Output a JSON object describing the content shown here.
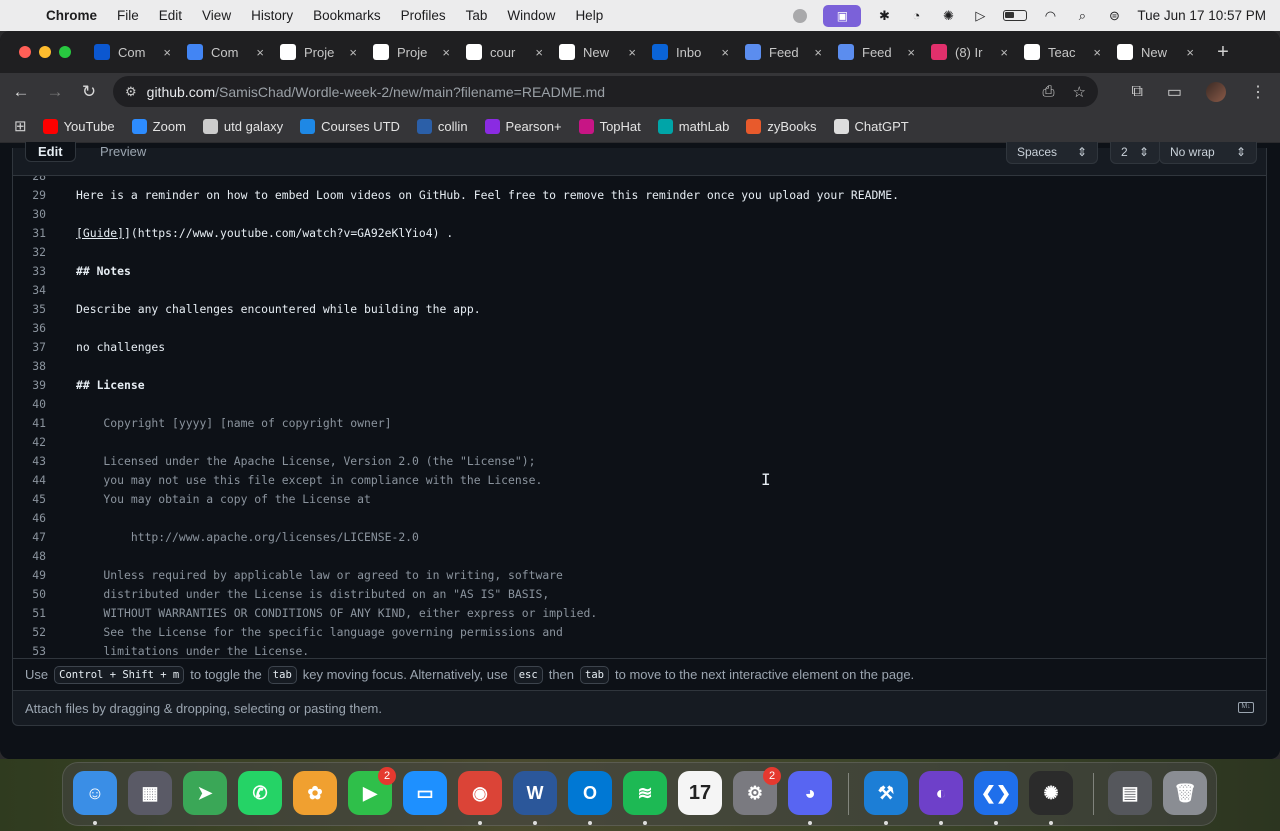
{
  "menubar": {
    "items": [
      "Chrome",
      "File",
      "Edit",
      "View",
      "History",
      "Bookmarks",
      "Profiles",
      "Tab",
      "Window",
      "Help"
    ],
    "clock": "Tue Jun 17  10:57 PM"
  },
  "tabs": [
    {
      "label": "Com",
      "icon": "docs",
      "color": "#0b57d0"
    },
    {
      "label": "Com",
      "icon": "docs",
      "color": "#4285f4"
    },
    {
      "label": "Proje",
      "icon": "codepath",
      "color": "#ffffff"
    },
    {
      "label": "Proje",
      "icon": "codepath",
      "color": "#ffffff"
    },
    {
      "label": "cour",
      "icon": "codepath",
      "color": "#ffffff"
    },
    {
      "label": "New",
      "icon": "github",
      "color": "#ffffff"
    },
    {
      "label": "Inbo",
      "icon": "outlook",
      "color": "#0a64d8"
    },
    {
      "label": "Feed",
      "icon": "feedback",
      "color": "#5b8def"
    },
    {
      "label": "Feed",
      "icon": "feedback",
      "color": "#5b8def"
    },
    {
      "label": "(8) Ir",
      "icon": "instagram",
      "color": "#e1306c"
    },
    {
      "label": "Teac",
      "icon": "openai",
      "color": "#ffffff"
    },
    {
      "label": "New",
      "icon": "chrome",
      "color": "#ffffff"
    }
  ],
  "address": {
    "host": "github.com",
    "path": "/SamisChad/Wordle-week-2/new/main?filename=README.md"
  },
  "bookmarks": [
    {
      "label": "YouTube",
      "color": "#ff0000"
    },
    {
      "label": "Zoom",
      "color": "#2d8cff"
    },
    {
      "label": "utd galaxy",
      "color": "#cccccc"
    },
    {
      "label": "Courses UTD",
      "color": "#1e88e5"
    },
    {
      "label": "collin",
      "color": "#2b5fa8"
    },
    {
      "label": "Pearson+",
      "color": "#8a2be2"
    },
    {
      "label": "TopHat",
      "color": "#c71585"
    },
    {
      "label": "mathLab",
      "color": "#00a5a8"
    },
    {
      "label": "zyBooks",
      "color": "#e85a2c"
    },
    {
      "label": "ChatGPT",
      "color": "#dddddd"
    }
  ],
  "editor": {
    "tab_edit": "Edit",
    "tab_preview": "Preview",
    "indent_mode": "Spaces",
    "indent_size": "2",
    "wrap_mode": "No wrap",
    "lines": [
      {
        "n": "28",
        "text": "",
        "style": ""
      },
      {
        "n": "29",
        "text": "Here is a reminder on how to embed Loom videos on GitHub. Feel free to remove this reminder once you upload your README.",
        "style": ""
      },
      {
        "n": "30",
        "text": "",
        "style": ""
      },
      {
        "n": "31",
        "text": "[Guide]](https://www.youtube.com/watch?v=GA92eKlYio4) .",
        "style": "link"
      },
      {
        "n": "32",
        "text": "",
        "style": ""
      },
      {
        "n": "33",
        "text": "## Notes",
        "style": "h"
      },
      {
        "n": "34",
        "text": "",
        "style": ""
      },
      {
        "n": "35",
        "text": "Describe any challenges encountered while building the app.",
        "style": ""
      },
      {
        "n": "36",
        "text": "",
        "style": ""
      },
      {
        "n": "37",
        "text": "no challenges",
        "style": ""
      },
      {
        "n": "38",
        "text": "",
        "style": ""
      },
      {
        "n": "39",
        "text": "## License",
        "style": "h"
      },
      {
        "n": "40",
        "text": "",
        "style": ""
      },
      {
        "n": "41",
        "text": "    Copyright [yyyy] [name of copyright owner]",
        "style": "muted"
      },
      {
        "n": "42",
        "text": "",
        "style": ""
      },
      {
        "n": "43",
        "text": "    Licensed under the Apache License, Version 2.0 (the \"License\");",
        "style": "muted"
      },
      {
        "n": "44",
        "text": "    you may not use this file except in compliance with the License.",
        "style": "muted"
      },
      {
        "n": "45",
        "text": "    You may obtain a copy of the License at",
        "style": "muted"
      },
      {
        "n": "46",
        "text": "",
        "style": ""
      },
      {
        "n": "47",
        "text": "        http://www.apache.org/licenses/LICENSE-2.0",
        "style": "muted"
      },
      {
        "n": "48",
        "text": "",
        "style": ""
      },
      {
        "n": "49",
        "text": "    Unless required by applicable law or agreed to in writing, software",
        "style": "muted"
      },
      {
        "n": "50",
        "text": "    distributed under the License is distributed on an \"AS IS\" BASIS,",
        "style": "muted"
      },
      {
        "n": "51",
        "text": "    WITHOUT WARRANTIES OR CONDITIONS OF ANY KIND, either express or implied.",
        "style": "muted"
      },
      {
        "n": "52",
        "text": "    See the License for the specific language governing permissions and",
        "style": "muted"
      },
      {
        "n": "53",
        "text": "    limitations under the License.",
        "style": "muted"
      }
    ]
  },
  "hint": {
    "use": "Use",
    "kbd1": "Control + Shift + m",
    "text1": "to toggle the",
    "kbd2": "tab",
    "text2": "key moving focus. Alternatively, use",
    "kbd3": "esc",
    "text3": "then",
    "kbd4": "tab",
    "text4": "to move to the next interactive element on the page."
  },
  "attach_text": "Attach files by dragging & dropping, selecting or pasting them.",
  "dock": {
    "items": [
      {
        "name": "finder",
        "glyph": "☺",
        "color": "#3a8ee6",
        "running": true,
        "badge": ""
      },
      {
        "name": "launchpad",
        "glyph": "▦",
        "color": "#5a5a66",
        "running": false,
        "badge": ""
      },
      {
        "name": "maps",
        "glyph": "➤",
        "color": "#3aa757",
        "running": false,
        "badge": ""
      },
      {
        "name": "whatsapp",
        "glyph": "✆",
        "color": "#25d366",
        "running": false,
        "badge": ""
      },
      {
        "name": "photos",
        "glyph": "✿",
        "color": "#f0a030",
        "running": false,
        "badge": ""
      },
      {
        "name": "facetime",
        "glyph": "▶",
        "color": "#2fbf4a",
        "running": false,
        "badge": "2"
      },
      {
        "name": "keynote",
        "glyph": "▭",
        "color": "#1e90ff",
        "running": false,
        "badge": ""
      },
      {
        "name": "chrome",
        "glyph": "◉",
        "color": "#db4437",
        "running": true,
        "badge": ""
      },
      {
        "name": "word",
        "glyph": "W",
        "color": "#2b579a",
        "running": true,
        "badge": ""
      },
      {
        "name": "outlook",
        "glyph": "O",
        "color": "#0078d4",
        "running": true,
        "badge": ""
      },
      {
        "name": "spotify",
        "glyph": "≋",
        "color": "#1db954",
        "running": true,
        "badge": ""
      },
      {
        "name": "calendar",
        "glyph": "17",
        "color": "#f5f5f5",
        "running": false,
        "badge": ""
      },
      {
        "name": "system-settings",
        "glyph": "⚙",
        "color": "#7a7a80",
        "running": false,
        "badge": "2"
      },
      {
        "name": "discord",
        "glyph": "◕",
        "color": "#5865f2",
        "running": true,
        "badge": ""
      },
      {
        "name": "xcode",
        "glyph": "⚒",
        "color": "#1c7ed6",
        "running": true,
        "badge": ""
      },
      {
        "name": "github-desktop",
        "glyph": "◐",
        "color": "#6e40c9",
        "running": true,
        "badge": ""
      },
      {
        "name": "vscode",
        "glyph": "❮❯",
        "color": "#1f6feb",
        "running": true,
        "badge": ""
      },
      {
        "name": "chatgpt",
        "glyph": "✺",
        "color": "#2b2b2b",
        "running": true,
        "badge": ""
      },
      {
        "name": "screenshot",
        "glyph": "▤",
        "color": "#55575c",
        "running": false,
        "badge": ""
      },
      {
        "name": "trash",
        "glyph": "🗑",
        "color": "#8a8d93",
        "running": false,
        "badge": ""
      }
    ]
  }
}
